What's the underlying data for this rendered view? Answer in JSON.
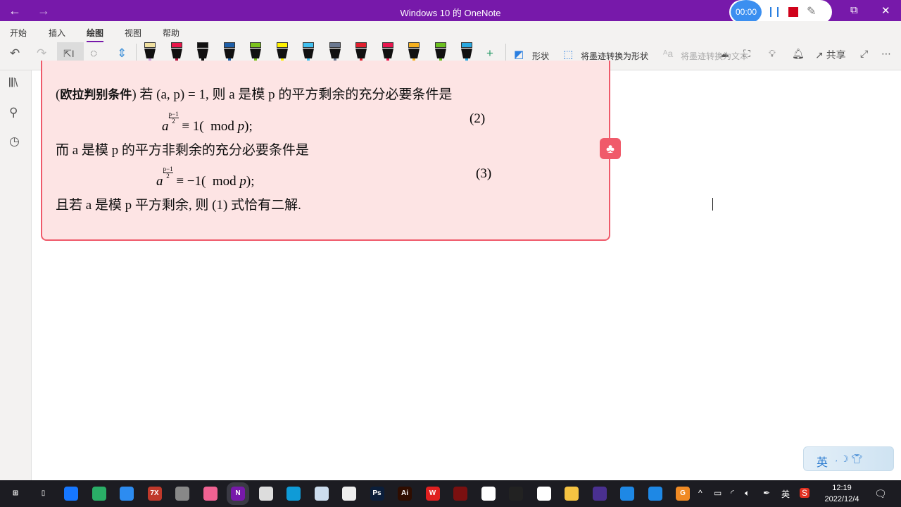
{
  "window": {
    "title": "Windows 10 的 OneNote",
    "back": "←",
    "forward": "→",
    "restore": "⧉",
    "close": "✕"
  },
  "recorder": {
    "timer": "00:00"
  },
  "ribbon": {
    "tabs": [
      "开始",
      "插入",
      "绘图",
      "视图",
      "帮助"
    ],
    "active_tab": "绘图",
    "pens": [
      {
        "cap": "#f0e0a0",
        "body": "#111",
        "tip": "#c9a0dc"
      },
      {
        "cap": "#e8174a",
        "body": "#111",
        "tip": "#b0103a"
      },
      {
        "cap": "#111",
        "body": "#111",
        "tip": "#111"
      },
      {
        "cap": "#1e5fa8",
        "body": "#111",
        "tip": "#1e5fa8"
      },
      {
        "cap": "#7bc21d",
        "body": "#111",
        "tip": "#7bc21d"
      },
      {
        "cap": "#fff200",
        "body": "#111",
        "tip": "#fff200"
      },
      {
        "cap": "#41c0f0",
        "body": "#111",
        "tip": "#41c0f0"
      },
      {
        "cap": "#6a7890",
        "body": "#111",
        "tip": "#6a7890"
      },
      {
        "cap": "#e0202e",
        "body": "#111",
        "tip": "#e0202e"
      },
      {
        "cap": "#e8164e",
        "body": "#111",
        "tip": "#e8164e"
      },
      {
        "cap": "#f4b020",
        "body": "#111",
        "tip": "#f4b020"
      },
      {
        "cap": "#6cc020",
        "body": "#111",
        "tip": "#6cc020"
      },
      {
        "cap": "#2aa8e0",
        "body": "#111",
        "tip": "#2aa8e0"
      }
    ],
    "add": "+",
    "shapes_label": "形状",
    "ink_to_shape_label": "将墨迹转换为形状",
    "ink_to_text_label": "将墨迹转换为文本",
    "share_label": "共享"
  },
  "note": {
    "l1_bold": "欧拉判别条件",
    "l1": "若 (a, p) = 1, 则 a 是模 p 的平方剩余的充分必要条件是",
    "eq2": "a^((p−1)/2) ≡ 1(  mod p);",
    "eq2_num": "(2)",
    "l3": "而 a 是模 p 的平方非剩余的充分必要条件是",
    "eq3_num": "(3)",
    "l5": "且若 a 是模 p 平方剩余, 则 (1) 式恰有二解.",
    "exp_num": "p−1",
    "exp_den": "2",
    "rhs2": " ≡ 1(  mod ",
    "rhs3": " ≡ −1(  mod ",
    "tail": ");"
  },
  "ime": {
    "lang": "英"
  },
  "taskbar": {
    "apps": [
      {
        "name": "start",
        "color": "#1c1c22",
        "label": "⊞"
      },
      {
        "name": "task-view",
        "color": "#1c1c22",
        "label": "▯"
      },
      {
        "name": "feishu",
        "color": "#1677ff",
        "label": ""
      },
      {
        "name": "wechat",
        "color": "#2aae67",
        "label": ""
      },
      {
        "name": "app-blue-ring",
        "color": "#2d8cf0",
        "label": ""
      },
      {
        "name": "7zip",
        "color": "#c0392b",
        "label": "7X"
      },
      {
        "name": "paint",
        "color": "#888",
        "label": ""
      },
      {
        "name": "app-pink",
        "color": "#f06292",
        "label": ""
      },
      {
        "name": "onenote",
        "color": "#7719aa",
        "label": "N"
      },
      {
        "name": "monitor",
        "color": "#ddd",
        "label": ""
      },
      {
        "name": "edge",
        "color": "#0f9bd7",
        "label": ""
      },
      {
        "name": "app-flower",
        "color": "#cde",
        "label": ""
      },
      {
        "name": "inkscape",
        "color": "#eee",
        "label": ""
      },
      {
        "name": "photoshop",
        "color": "#0b1e3a",
        "label": "Ps"
      },
      {
        "name": "illustrator",
        "color": "#2f0d00",
        "label": "Ai"
      },
      {
        "name": "wps",
        "color": "#e02020",
        "label": "W"
      },
      {
        "name": "app-dark-red",
        "color": "#7a1010",
        "label": ""
      },
      {
        "name": "app-gear",
        "color": "#fff",
        "label": ""
      },
      {
        "name": "qq",
        "color": "#222",
        "label": ""
      },
      {
        "name": "app-red-green",
        "color": "#fff",
        "label": ""
      },
      {
        "name": "file-explorer",
        "color": "#f5c342",
        "label": ""
      },
      {
        "name": "app-purple",
        "color": "#4a3090",
        "label": ""
      },
      {
        "name": "app-q1",
        "color": "#1e88e5",
        "label": ""
      },
      {
        "name": "app-q2",
        "color": "#1e88e5",
        "label": ""
      },
      {
        "name": "app-orange",
        "color": "#f08a24",
        "label": "G"
      }
    ],
    "tray_ime": "英",
    "time": "12:19",
    "date": "2022/12/4"
  }
}
